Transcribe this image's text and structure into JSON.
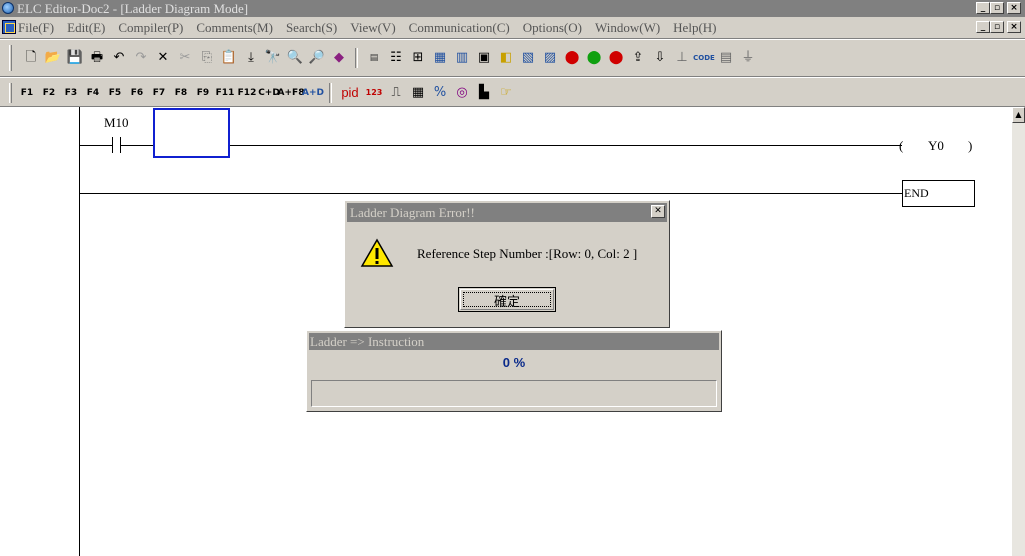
{
  "window": {
    "title": "ELC Editor-Doc2 - [Ladder Diagram Mode]",
    "controls": [
      "_",
      "▫",
      "×"
    ]
  },
  "menu": [
    "File(F)",
    "Edit(E)",
    "Compiler(P)",
    "Comments(M)",
    "Search(S)",
    "View(V)",
    "Communication(C)",
    "Options(O)",
    "Window(W)",
    "Help(H)"
  ],
  "toolbar1": {
    "standard": [
      "new-icon",
      "open-icon",
      "save-icon",
      "print-icon",
      "undo-icon",
      "redo-icon",
      "delete-icon",
      "cut-icon",
      "copy-icon",
      "paste-icon",
      "paste-special-icon",
      "find-icon",
      "zoom-in-icon",
      "zoom-out-icon",
      "eraser-icon"
    ],
    "plc": [
      "lo-end-icon",
      "instruction-list-icon",
      "ladder-icon",
      "sfc-icon",
      "monitor-icon",
      "table-icon",
      "tag-icon",
      "io-icon",
      "module-icon",
      "stop-red-icon",
      "run-icon",
      "stop-icon",
      "upload-icon",
      "download-icon",
      "contact-icon",
      "code-icon",
      "binary-icon",
      "transfer-icon"
    ],
    "code_label": "CODE"
  },
  "toolbar2": {
    "ladder_tools": [
      {
        "name": "f1-no-contact",
        "label": "F1"
      },
      {
        "name": "f2-nc-contact",
        "label": "F2"
      },
      {
        "name": "f3-rising-contact",
        "label": "F3"
      },
      {
        "name": "f4-falling-contact",
        "label": "F4"
      },
      {
        "name": "f5-coil",
        "label": "F5"
      },
      {
        "name": "f6-application",
        "label": "F6"
      },
      {
        "name": "f7-application-instr",
        "label": "F7"
      },
      {
        "name": "f8-line-horizontal",
        "label": "F8"
      },
      {
        "name": "f9-line-vertical",
        "label": "F9"
      },
      {
        "name": "f11-pulse-up",
        "label": "F11"
      },
      {
        "name": "f12-pulse-down",
        "label": "F12"
      },
      {
        "name": "c-d-delete",
        "label": "C+D"
      },
      {
        "name": "a-f8-insert",
        "label": "A+F8"
      },
      {
        "name": "a-d-delete-line",
        "label": "A+D"
      }
    ],
    "extra": {
      "pid": "pid",
      "n123": "123"
    }
  },
  "ladder": {
    "contact_label": "M10",
    "coil_label": "Y0",
    "end_label": "END"
  },
  "error_dialog": {
    "title": "Ladder Diagram Error!!",
    "message": "Reference Step Number :[Row: 0, Col: 2 ]",
    "ok_label": "確定"
  },
  "progress_dialog": {
    "title": "Ladder => Instruction",
    "percent_text": "0 %",
    "progress": 0
  }
}
